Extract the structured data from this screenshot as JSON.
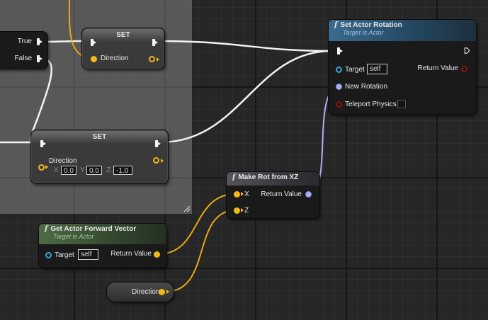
{
  "graph": {
    "branch": {
      "true_label": "True",
      "false_label": "False"
    },
    "set_top": {
      "title": "SET",
      "var_label": "Direction"
    },
    "set_bottom": {
      "title": "SET",
      "var_label": "Direction",
      "x_label": "X",
      "x_value": "0.0",
      "y_label": "Y",
      "y_value": "0.0",
      "z_label": "Z",
      "z_value": "-1.0"
    },
    "set_rotation": {
      "title": "Set Actor Rotation",
      "subtitle": "Target is Actor",
      "target_label": "Target",
      "target_value": "self",
      "return_label": "Return Value",
      "new_rotation_label": "New Rotation",
      "teleport_label": "Teleport Physics"
    },
    "make_rot": {
      "title": "Make Rot from XZ",
      "x_label": "X",
      "z_label": "Z",
      "return_label": "Return Value"
    },
    "forward": {
      "title": "Get Actor Forward Vector",
      "subtitle": "Target is Actor",
      "target_label": "Target",
      "target_value": "self",
      "return_label": "Return Value"
    },
    "direction_get": {
      "label": "Direction"
    },
    "function_glyph": "f"
  },
  "colors": {
    "exec": "#f2f2f2",
    "vector": "#f2b81a",
    "rotator": "#a9b2f0",
    "object": "#3aa7d8",
    "bool": "#8a1212"
  }
}
